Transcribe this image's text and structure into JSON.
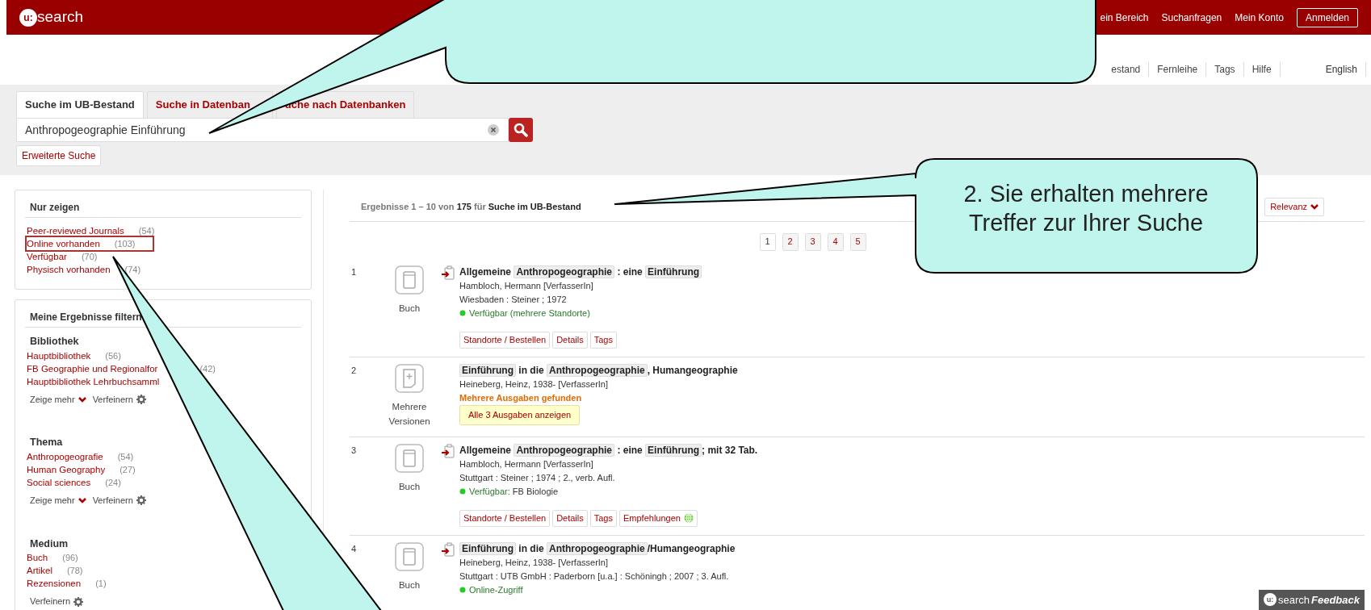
{
  "header": {
    "logo_mark": "u:",
    "logo_text": "search",
    "links": [
      "ein Bereich",
      "Suchanfragen",
      "Mein Konto"
    ],
    "login_button": "Anmelden"
  },
  "secondary_nav": {
    "links": [
      "estand",
      "Fernleihe",
      "Tags",
      "Hilfe"
    ],
    "language": "English"
  },
  "search_tabs": [
    {
      "label": "Suche im UB-Bestand",
      "selected": true
    },
    {
      "label": "Suche in Datenban",
      "selected": false
    },
    {
      "label": "uche nach Datenbanken",
      "selected": false
    }
  ],
  "search": {
    "value": "Anthropogeographie Einführung",
    "advanced_button": "Erweiterte Suche"
  },
  "show_only": {
    "title": "Nur zeigen",
    "items": [
      {
        "label": "Peer-reviewed Journals",
        "count": "(54)",
        "highlighted": false
      },
      {
        "label": "Online vorhanden",
        "count": "(103)",
        "highlighted": true
      },
      {
        "label": "Verfügbar",
        "count": "(70)",
        "highlighted": false
      },
      {
        "label": "Physisch vorhanden",
        "count": "(74)",
        "highlighted": false
      }
    ]
  },
  "filters": {
    "title": "Meine Ergebnisse filtern",
    "groups": [
      {
        "title": "Bibliothek",
        "items": [
          {
            "label": "Hauptbibliothek",
            "count": "(56)"
          },
          {
            "label": "FB Geographie und Regionalfor",
            "count": "(42)"
          },
          {
            "label": "Hauptbibliothek Lehrbuchsamml"
          }
        ],
        "more": "Zeige mehr",
        "refine": "Verfeinern"
      },
      {
        "title": "Thema",
        "items": [
          {
            "label": "Anthropogeografie",
            "count": "(54)"
          },
          {
            "label": "Human Geography",
            "count": "(27)"
          },
          {
            "label": "Social sciences",
            "count": "(24)"
          }
        ],
        "more": "Zeige mehr",
        "refine": "Verfeinern"
      },
      {
        "title": "Medium",
        "items": [
          {
            "label": "Buch",
            "count": "(96)"
          },
          {
            "label": "Artikel",
            "count": "(78)"
          },
          {
            "label": "Rezensionen",
            "count": "(1)"
          }
        ],
        "refine": "Verfeinern"
      }
    ]
  },
  "results_header": {
    "range": "Ergebnisse 1 – 10 von",
    "total": "175",
    "for": "für",
    "scope": "Suche im UB-Bestand",
    "sort": "Relevanz"
  },
  "pagination": [
    {
      "label": "1",
      "selected": true
    },
    {
      "label": "2",
      "selected": false
    },
    {
      "label": "3",
      "selected": false
    },
    {
      "label": "4",
      "selected": false
    },
    {
      "label": "5",
      "selected": false
    }
  ],
  "results": [
    {
      "number": "1",
      "kind": "book",
      "type_label": [
        "Buch"
      ],
      "export": true,
      "title": [
        {
          "text": "Allgemeine",
          "highlight": false
        },
        {
          "text": "Anthropogeographie",
          "highlight": true
        },
        {
          "text": ": eine",
          "highlight": false
        },
        {
          "text": "Einführung",
          "highlight": true
        }
      ],
      "author": "Hambloch, Hermann [VerfasserIn]",
      "imprint": "Wiesbaden : Steiner ; 1972",
      "availability": {
        "label": "Verfügbar (mehrere Standorte)"
      },
      "actions": [
        {
          "label": "Standorte / Bestellen",
          "kind": "plain"
        },
        {
          "label": "Details",
          "kind": "plain"
        },
        {
          "label": "Tags",
          "kind": "plain"
        }
      ]
    },
    {
      "number": "2",
      "kind": "versions",
      "type_label": [
        "Mehrere",
        "Versionen"
      ],
      "export": false,
      "title": [
        {
          "text": "Einführung",
          "highlight": true
        },
        {
          "text": "in die",
          "highlight": false
        },
        {
          "text": "Anthropogeographie",
          "highlight": true
        },
        {
          "text": ", Humangeographie",
          "highlight": false
        }
      ],
      "author": "Heineberg, Heinz, 1938- [VerfasserIn]",
      "versions_note": "Mehrere Ausgaben gefunden",
      "versions_button": "Alle 3 Ausgaben anzeigen"
    },
    {
      "number": "3",
      "kind": "book",
      "type_label": [
        "Buch"
      ],
      "export": true,
      "title": [
        {
          "text": "Allgemeine",
          "highlight": false
        },
        {
          "text": "Anthropogeographie",
          "highlight": true
        },
        {
          "text": ": eine",
          "highlight": false
        },
        {
          "text": "Einführung",
          "highlight": true
        },
        {
          "text": "; mit 32 Tab.",
          "highlight": false
        }
      ],
      "author": "Hambloch, Hermann [VerfasserIn]",
      "imprint": "Stuttgart : Steiner ; 1974 ; 2., verb. Aufl.",
      "availability": {
        "label": "Verfügbar:",
        "detail": "FB Biologie"
      },
      "actions": [
        {
          "label": "Standorte / Bestellen",
          "kind": "plain"
        },
        {
          "label": "Details",
          "kind": "plain"
        },
        {
          "label": "Tags",
          "kind": "plain"
        },
        {
          "label": "Empfehlungen",
          "kind": "recommend"
        }
      ]
    },
    {
      "number": "4",
      "kind": "book",
      "type_label": [
        "Buch"
      ],
      "export": true,
      "title": [
        {
          "text": "Einführung",
          "highlight": true
        },
        {
          "text": "in die",
          "highlight": false
        },
        {
          "text": "Anthropogeographie",
          "highlight": true
        },
        {
          "text": "/Humangeographie",
          "highlight": false
        }
      ],
      "author": "Heineberg, Heinz, 1938- [VerfasserIn]",
      "imprint": "Stuttgart : UTB GmbH : Paderborn [u.a.] : Schöningh ; 2007 ; 3. Aufl.",
      "availability": {
        "label": "Online-Zugriff"
      }
    }
  ],
  "callout": {
    "text": "2. Sie erhalten mehrere Treffer zur Ihrer Suche"
  },
  "feedback": {
    "logo_mark": "u:",
    "logo_text": "search",
    "label": "Feedback"
  }
}
